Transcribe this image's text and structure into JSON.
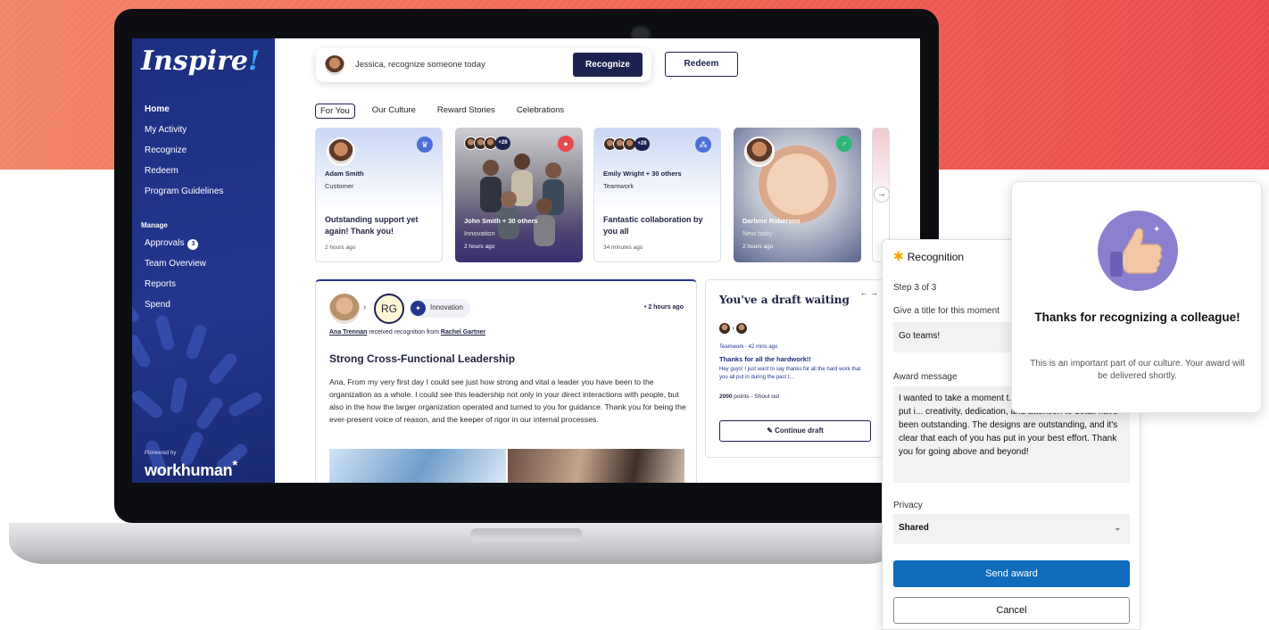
{
  "sidebar": {
    "logo": "Inspire",
    "logo_mark": "!",
    "nav": [
      "Home",
      "My Activity",
      "Recognize",
      "Redeem",
      "Program Guidelines"
    ],
    "manage_heading": "Manage",
    "manage": [
      "Approvals",
      "Team Overview",
      "Reports",
      "Spend"
    ],
    "approvals_count": "3",
    "pioneered_by": "Pioneered by",
    "brand": "workhuman",
    "brand_mark": "*"
  },
  "topbar": {
    "prompt": "Jessica, recognize someone today",
    "recognize_label": "Recognize",
    "redeem_label": "Redeem"
  },
  "tabs": [
    "For You",
    "Our Culture",
    "Reward Stories",
    "Celebrations"
  ],
  "cards": [
    {
      "name": "Adam Smith",
      "sub": "Customer",
      "title": "Outstanding support yet again! Thank you!",
      "time": "2 hours ago"
    },
    {
      "name": "John Smith + 30 others",
      "sub": "Innovation",
      "title": "",
      "time": "2 hours ago",
      "group_count": "+28"
    },
    {
      "name": "Emily Wright + 30 others",
      "sub": "Teamwork",
      "title": "Fantastic collaboration by you all",
      "time": "34 minutes ago",
      "group_count": "+28"
    },
    {
      "name": "Darlene Roberson",
      "sub": "New baby",
      "title": "",
      "time": "2 hours ago"
    }
  ],
  "feed": {
    "initials": "RG",
    "category": "Innovation",
    "time": "2 hours ago",
    "recipient": "Ana Trennan",
    "received_text": "received recognition from",
    "giver": "Rachel Gartner",
    "title": "Strong Cross-Functional Leadership",
    "body": "Ana, From my very first day I could see just how strong and vital a leader you have been to the organization as a whole.  I could see this leadership not only in your direct interactions with people, but also in the how the larger organization operated and turned to you for guidance. Thank you for being the ever-present voice of reason, and the keeper of rigor in our internal processes."
  },
  "draft": {
    "heading": "You've a draft waiting",
    "meta": "Teamwork · 42 mins ago",
    "title": "Thanks for all the hardwork!!",
    "preview": "Hey guys! I just want to say thanks for all the hard work that you all put in during the past t...",
    "points": "2000",
    "points_suffix": "points - Shout out",
    "continue_label": "Continue draft"
  },
  "recognition_panel": {
    "header": "Recognition",
    "step": "Step 3 of 3",
    "title_label": "Give a title for this moment",
    "title_value": "Go teams!",
    "message_label": "Award message",
    "message_value": "I wanted to take a moment t... all the hard work you've put i... creativity, dedication, and attention to detail have been outstanding. The designs are outstanding, and it's clear that each of you has put in your best effort. Thank you for going above and beyond!",
    "privacy_label": "Privacy",
    "privacy_value": "Shared",
    "send_label": "Send award",
    "cancel_label": "Cancel"
  },
  "thanks": {
    "heading": "Thanks for recognizing a colleague!",
    "body": "This is an important part of our culture. Your award will be delivered shortly."
  },
  "colors": {
    "accent": "#1c2250",
    "sidebar": "#22368f",
    "send": "#0f6cbd",
    "thumb_bg": "#8b80cf"
  }
}
